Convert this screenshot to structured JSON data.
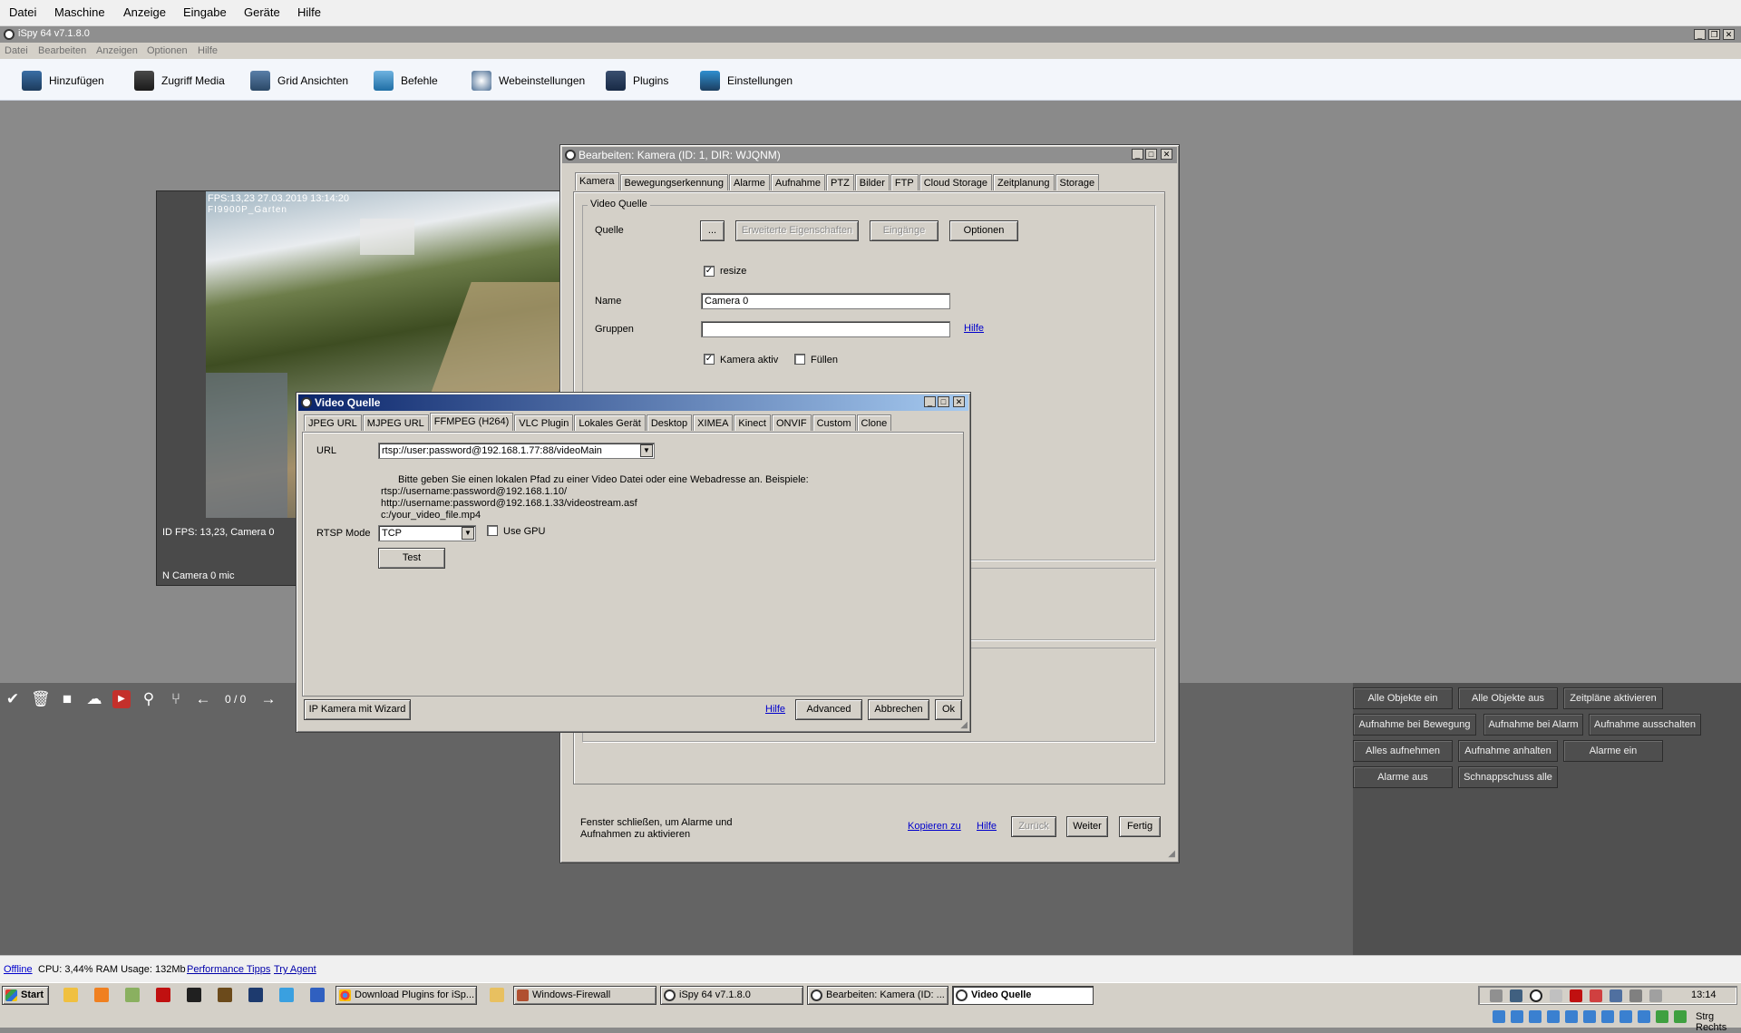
{
  "vbox_menu": [
    "Datei",
    "Maschine",
    "Anzeige",
    "Eingabe",
    "Geräte",
    "Hilfe"
  ],
  "ispy_title": "iSpy 64 v7.1.8.0",
  "ispy_menu": [
    "Datei",
    "Bearbeiten",
    "Anzeigen",
    "Optionen",
    "Hilfe"
  ],
  "toolbar": {
    "add": "Hinzufügen",
    "media": "Zugriff Media",
    "grid": "Grid Ansichten",
    "commands": "Befehle",
    "web": "Webeinstellungen",
    "plugins": "Plugins",
    "settings": "Einstellungen"
  },
  "camera_tile": {
    "overlay_line1": "FPS:13,23 27.03.2019 13:14:20",
    "overlay_line2": "FI9900P_Garten",
    "status_line": "ID  FPS: 13,23, Camera 0",
    "mic_line": "N  Camera 0 mic",
    "counter": "0 / 0"
  },
  "right_buttons": [
    [
      "Alle Objekte ein",
      "Alle Objekte aus",
      "Zeitpläne aktivieren"
    ],
    [
      "Aufnahme bei Bewegung",
      "Aufnahme bei Alarm",
      "Aufnahme ausschalten"
    ],
    [
      "Alles aufnehmen",
      "Aufnahme anhalten",
      "Alarme ein"
    ],
    [
      "Alarme aus",
      "Schnappschuss alle"
    ]
  ],
  "edit_dialog": {
    "title": "Bearbeiten: Kamera (ID: 1, DIR: WJQNM)",
    "tabs": [
      "Kamera",
      "Bewegungserkennung",
      "Alarme",
      "Aufnahme",
      "PTZ",
      "Bilder",
      "FTP",
      "Cloud Storage",
      "Zeitplanung",
      "Storage"
    ],
    "group_title": "Video Quelle",
    "source_label": "Quelle",
    "source_btn": "...",
    "extended_props": "Erweiterte Eigenschaften",
    "inputs_btn": "Eingänge",
    "options_btn": "Optionen",
    "resize_label": "resize",
    "name_label": "Name",
    "name_value": "Camera 0",
    "groups_label": "Gruppen",
    "groups_value": "",
    "help_link": "Hilfe",
    "camera_active": "Kamera aktiv",
    "fill": "Füllen",
    "footer_text": "Fenster schließen, um Alarme und Aufnahmen zu aktivieren",
    "copy_link": "Kopieren zu",
    "help_link2": "Hilfe",
    "back_btn": "Zurück",
    "next_btn": "Weiter",
    "done_btn": "Fertig"
  },
  "source_dialog": {
    "title": "Video Quelle",
    "tabs": [
      "JPEG URL",
      "MJPEG URL",
      "FFMPEG (H264)",
      "VLC Plugin",
      "Lokales Gerät",
      "Desktop",
      "XIMEA",
      "Kinect",
      "ONVIF",
      "Custom",
      "Clone"
    ],
    "url_label": "URL",
    "url_value": "rtsp://user:password@192.168.1.77:88/videoMain",
    "hint_1": "Bitte geben Sie einen lokalen Pfad zu einer Video Datei oder eine Webadresse an. Beispiele:",
    "hint_2": "rtsp://username:password@192.168.1.10/",
    "hint_3": "http://username:password@192.168.1.33/videostream.asf",
    "hint_4": "c:/your_video_file.mp4",
    "rtsp_label": "RTSP Mode",
    "rtsp_value": "TCP",
    "gpu_label": "Use GPU",
    "test_btn": "Test",
    "wizard_btn": "IP Kamera mit Wizard",
    "help_link": "Hilfe",
    "advanced_btn": "Advanced",
    "cancel_btn": "Abbrechen",
    "ok_btn": "Ok"
  },
  "status_bar": {
    "offline": "Offline",
    "cpu": "CPU: 3,44% RAM Usage: 132Mb",
    "perf": "Performance Tipps",
    "agent": "Try Agent"
  },
  "taskbar": {
    "start": "Start",
    "tasks": [
      "Download Plugins for iSp...",
      "Windows-Firewall",
      "iSpy 64 v7.1.8.0",
      "Bearbeiten: Kamera (ID: ...",
      "Video Quelle"
    ],
    "clock": "13:14",
    "host_key": "Strg Rechts"
  }
}
